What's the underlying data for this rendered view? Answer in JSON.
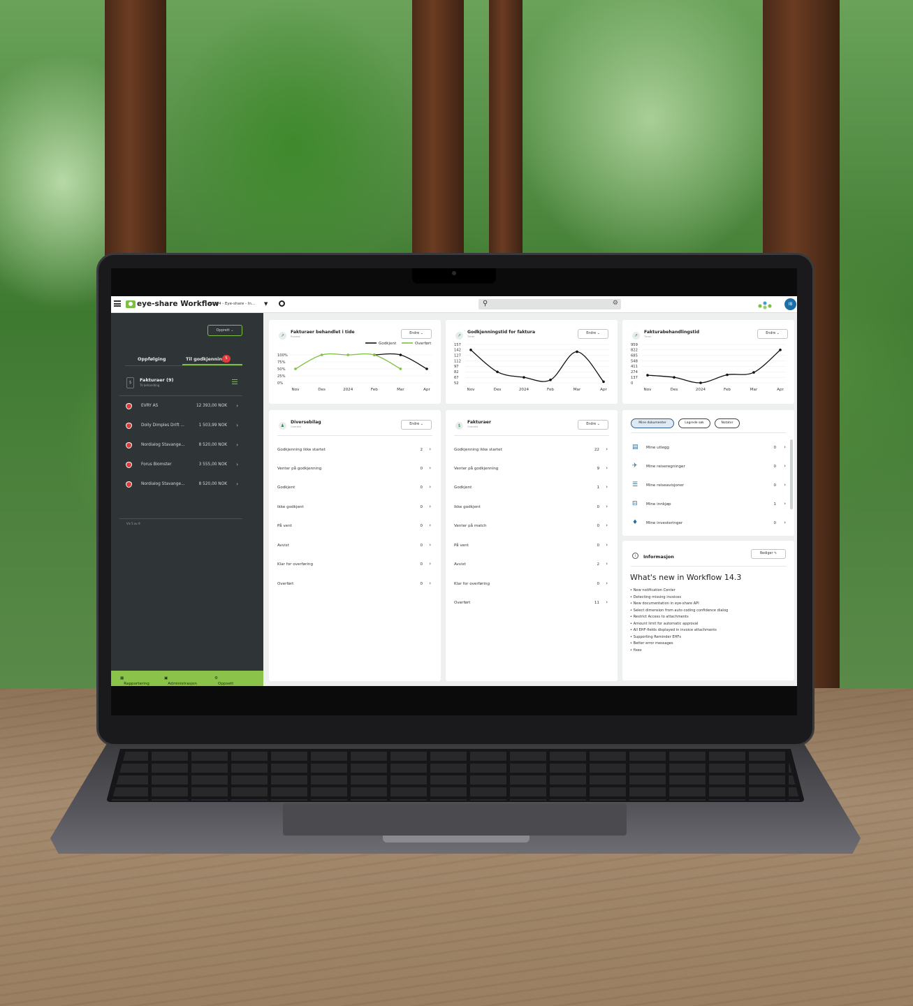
{
  "app": {
    "title": "eye-share Workflow",
    "client": "ES184 - Eye-share - In...",
    "user_initials": "IB"
  },
  "colors": {
    "accent": "#7bc043",
    "sidebar_bg": "#2f3436",
    "footer_bg": "#8bc34a",
    "badge_red": "#e03b3b",
    "link_blue": "#1a6fa8"
  },
  "icons": {
    "menu": "hamburger-icon",
    "logo": "eye-share-logo",
    "settings": "gear-icon",
    "search": "search-icon",
    "network": "network-icon"
  },
  "sidebar": {
    "create_label": "Opprett",
    "tabs": [
      {
        "label": "Oppfølging"
      },
      {
        "label": "Til godkjenning",
        "badge": "5"
      }
    ],
    "invoices": {
      "title": "Fakturaer (9)",
      "subtitle": "Til behandling",
      "items": [
        {
          "name": "EVRY AS",
          "amount": "12 393,00 NOK"
        },
        {
          "name": "Dolly Dimples Drift ...",
          "amount": "1 503,99 NOK"
        },
        {
          "name": "Nordialog Stavange...",
          "amount": "8 520,00 NOK"
        },
        {
          "name": "Forus Blomster",
          "amount": "3 555,00 NOK"
        },
        {
          "name": "Nordialog Stavange...",
          "amount": "8 520,00 NOK"
        }
      ],
      "show_more": "Vis 5 av 9"
    },
    "footer": [
      {
        "icon": "report-icon",
        "label": "Rapportering"
      },
      {
        "icon": "admin-icon",
        "label": "Administrasjon"
      },
      {
        "icon": "gear-icon",
        "label": "Oppsett"
      }
    ]
  },
  "cards": {
    "processed_over_time": {
      "title": "Fakturaer behandlet i tide",
      "subtitle": "Prosent",
      "edit_label": "Endre"
    },
    "approval_time": {
      "title": "Godkjenningstid for faktura",
      "subtitle": "Timer",
      "edit_label": "Endre"
    },
    "processing_time": {
      "title": "Fakturabehandlingstid",
      "subtitle": "Timer",
      "edit_label": "Endre"
    },
    "misc_docs": {
      "title": "Diversebilag",
      "subtitle": "Oversikt",
      "edit_label": "Endre",
      "rows": [
        {
          "label": "Godkjenning ikke startet",
          "count": "2"
        },
        {
          "label": "Venter på godkjenning",
          "count": "0"
        },
        {
          "label": "Godkjent",
          "count": "0"
        },
        {
          "label": "Ikke godkjent",
          "count": "0"
        },
        {
          "label": "På vent",
          "count": "0"
        },
        {
          "label": "Avvist",
          "count": "0"
        },
        {
          "label": "Klar for overføring",
          "count": "0"
        },
        {
          "label": "Overført",
          "count": "0"
        }
      ]
    },
    "invoices": {
      "title": "Fakturaer",
      "subtitle": "Oversikt",
      "edit_label": "Endre",
      "rows": [
        {
          "label": "Godkjenning ikke startet",
          "count": "22"
        },
        {
          "label": "Venter på godkjenning",
          "count": "9"
        },
        {
          "label": "Godkjent",
          "count": "1"
        },
        {
          "label": "Ikke godkjent",
          "count": "0"
        },
        {
          "label": "Venter på match",
          "count": "0"
        },
        {
          "label": "På vent",
          "count": "0"
        },
        {
          "label": "Avvist",
          "count": "2"
        },
        {
          "label": "Klar for overføring",
          "count": "0"
        },
        {
          "label": "Overført",
          "count": "11"
        }
      ]
    },
    "my_docs": {
      "pills": [
        "Mine dokumenter",
        "Lagrede søk",
        "Notater"
      ],
      "rows": [
        {
          "icon": "receipt-icon",
          "label": "Mine utlegg",
          "count": "0"
        },
        {
          "icon": "airplane-icon",
          "label": "Mine reiseregninger",
          "count": "0"
        },
        {
          "icon": "list-icon",
          "label": "Mine reiseavisjoner",
          "count": "0"
        },
        {
          "icon": "basket-icon",
          "label": "Mine innkjøp",
          "count": "1"
        },
        {
          "icon": "investment-icon",
          "label": "Mine investeringer",
          "count": "0"
        }
      ]
    },
    "info": {
      "title": "Informasjon",
      "edit_label": "Rediger",
      "heading": "What's new in Workflow 14.3",
      "items": [
        "• New notification Center",
        "• Detecting missing invoices",
        "• New documentation in eye-share API",
        "• Select dimension from auto coding confidence dialog",
        "• Restrict Access to attachments",
        "• Amount limit for automatic approval",
        "• All EHF-fields displayed in invoice attachments",
        "• Supporting Reminder EHFs",
        "• Better error messages",
        "• fixes"
      ]
    }
  },
  "chart_data": [
    {
      "type": "line",
      "title": "Fakturaer behandlet i tide",
      "subtitle": "Prosent",
      "categories": [
        "Nov",
        "Des",
        "2024",
        "Feb",
        "Mar",
        "Apr"
      ],
      "y_ticks": [
        "100%",
        "75%",
        "50%",
        "25%",
        "0%"
      ],
      "ylim": [
        0,
        100
      ],
      "legend": "top-right",
      "series": [
        {
          "name": "Godkjent",
          "color": "#111111",
          "values": [
            null,
            null,
            null,
            100,
            100,
            50
          ]
        },
        {
          "name": "Overført",
          "color": "#7bc043",
          "values": [
            50,
            100,
            100,
            100,
            50,
            null
          ]
        }
      ]
    },
    {
      "type": "line",
      "title": "Godkjenningstid for faktura",
      "subtitle": "Timer",
      "categories": [
        "Nov",
        "Des",
        "2024",
        "Feb",
        "Mar",
        "Apr"
      ],
      "y_ticks": [
        "157",
        "142",
        "127",
        "112",
        "97",
        "82",
        "67",
        "52"
      ],
      "ylim": [
        52,
        157
      ],
      "series": [
        {
          "name": "",
          "color": "#111111",
          "values": [
            142,
            82,
            67,
            60,
            137,
            55
          ]
        }
      ]
    },
    {
      "type": "line",
      "title": "Fakturabehandlingstid",
      "subtitle": "Timer",
      "categories": [
        "Nov",
        "Des",
        "2024",
        "Feb",
        "Mar",
        "Apr"
      ],
      "y_ticks": [
        "959",
        "822",
        "685",
        "548",
        "411",
        "274",
        "137",
        "0"
      ],
      "ylim": [
        0,
        959
      ],
      "series": [
        {
          "name": "",
          "color": "#111111",
          "values": [
            190,
            137,
            0,
            200,
            260,
            822
          ]
        }
      ]
    }
  ]
}
